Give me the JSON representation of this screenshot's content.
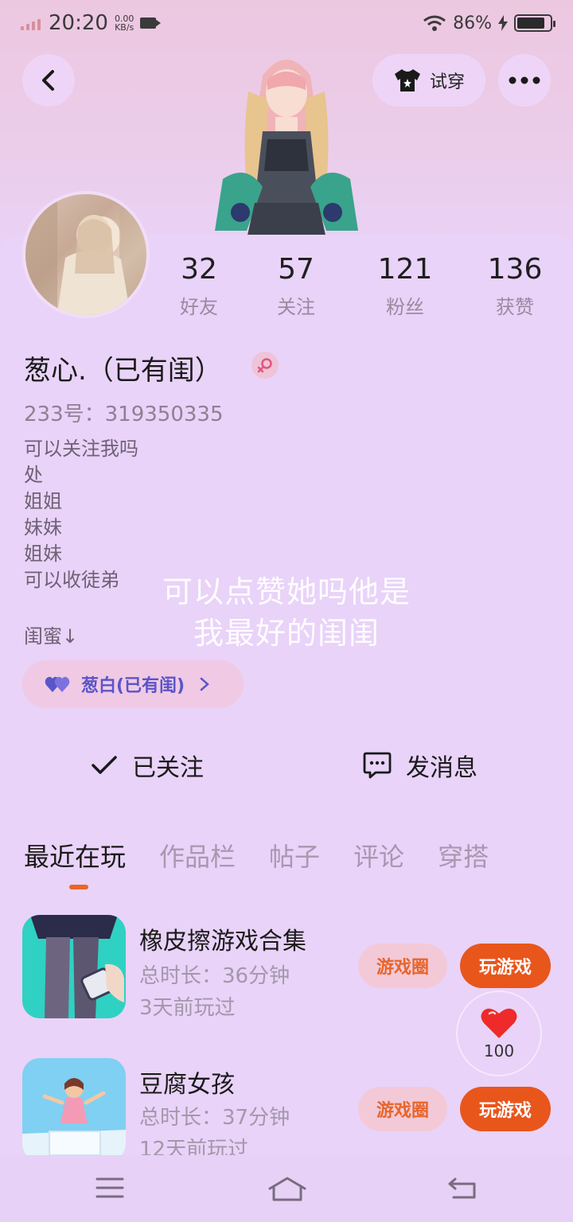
{
  "status_bar": {
    "time": "20:20",
    "net_speed_value": "0.00",
    "net_speed_unit": "KB/s",
    "battery_percent": "86%",
    "battery_level": 0.86
  },
  "header": {
    "try_on_label": "试穿"
  },
  "profile": {
    "stats": [
      {
        "value": "32",
        "label": "好友"
      },
      {
        "value": "57",
        "label": "关注"
      },
      {
        "value": "121",
        "label": "粉丝"
      },
      {
        "value": "136",
        "label": "获赞"
      }
    ],
    "nickname": "葱心.（已有闺）",
    "uid": "233号：319350335",
    "bio_lines": [
      "可以关注我吗",
      "处",
      "姐姐",
      "妹妹",
      "姐妹",
      "可以收徒弟"
    ],
    "bff_label": "闺蜜↓",
    "bff_chip": "葱白(已有闺)",
    "overlay_text_line1": "可以点赞她吗他是",
    "overlay_text_line2": "我最好的闺闺"
  },
  "actions": {
    "following": "已关注",
    "message": "发消息"
  },
  "tabs": [
    "最近在玩",
    "作品栏",
    "帖子",
    "评论",
    "穿搭"
  ],
  "games": [
    {
      "name": "橡皮擦游戏合集",
      "duration": "总时长：36分钟",
      "last_played": "3天前玩过",
      "circle_label": "游戏圈",
      "play_label": "玩游戏"
    },
    {
      "name": "豆腐女孩",
      "duration": "总时长：37分钟",
      "last_played": "12天前玩过",
      "circle_label": "游戏圈",
      "play_label": "玩游戏"
    }
  ],
  "like_float": {
    "count": "100"
  },
  "colors": {
    "accent": "#e8561c",
    "background": "#e9d3f8",
    "chip_text": "#5a55c8"
  }
}
